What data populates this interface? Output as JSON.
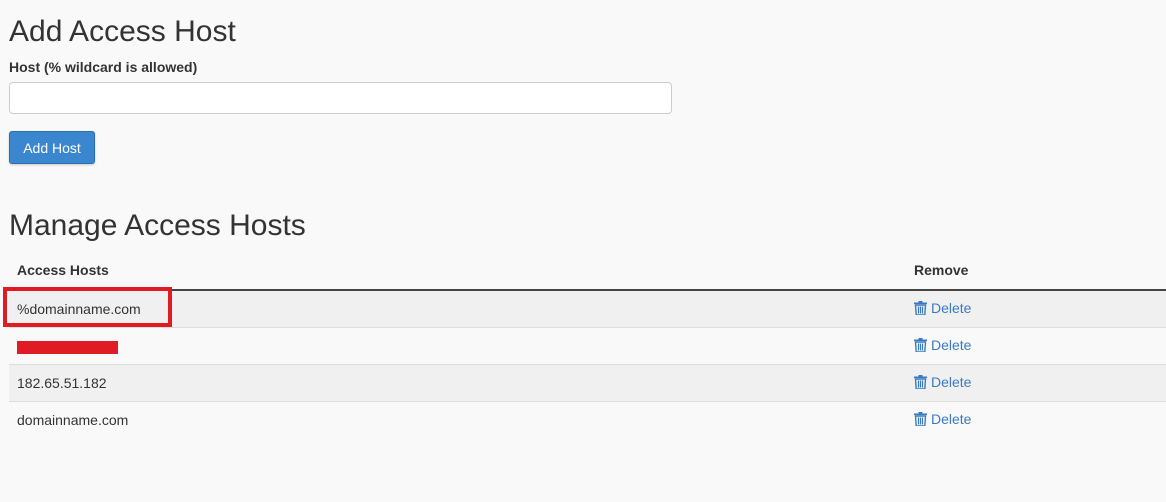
{
  "add_section": {
    "title": "Add Access Host",
    "host_label": "Host (% wildcard is allowed)",
    "host_input_value": "",
    "host_input_placeholder": "",
    "add_button_label": "Add Host"
  },
  "manage_section": {
    "title": "Manage Access Hosts",
    "columns": {
      "host": "Access Hosts",
      "remove": "Remove"
    },
    "rows": [
      {
        "host": "%domainname.com",
        "action": "Delete"
      },
      {
        "host": "",
        "action": "Delete"
      },
      {
        "host": "182.65.51.182",
        "action": "Delete"
      },
      {
        "host": "domainname.com",
        "action": "Delete"
      }
    ]
  },
  "colors": {
    "primary_button": "#3b87cf",
    "link": "#3a7bc0",
    "annotation_red": "#e01b24"
  }
}
